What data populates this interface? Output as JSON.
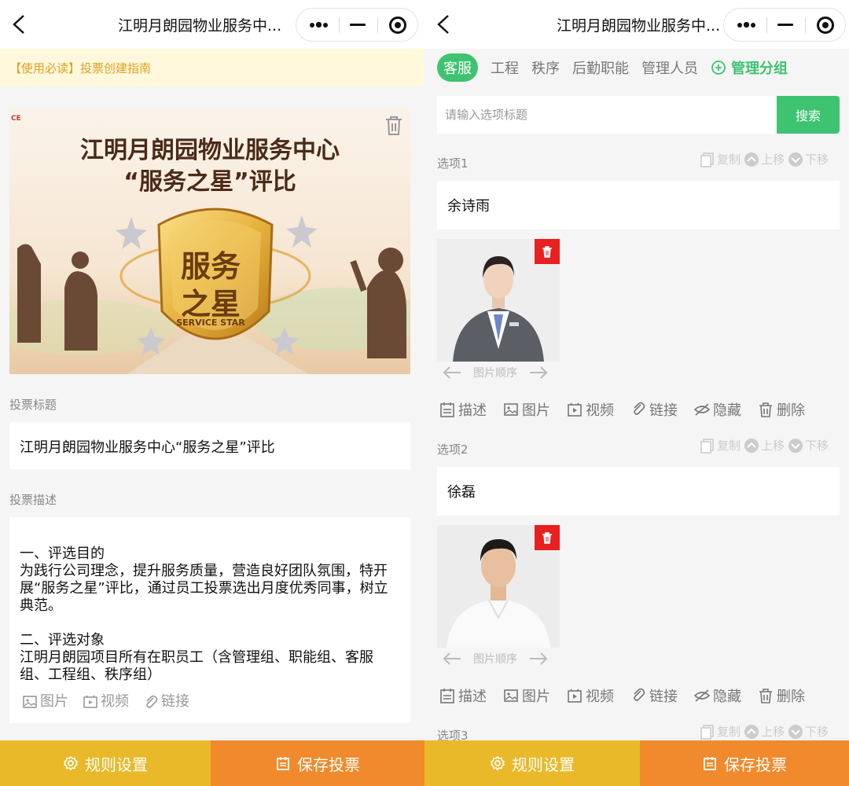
{
  "navbar": {
    "title": "江明月朗园物业服务中..."
  },
  "left": {
    "notice": "【使用必读】投票创建指南",
    "cover": {
      "line1": "江明月朗园物业服务中心",
      "line2": "“服务之星”评比",
      "badge_line1": "服务",
      "badge_line2": "之星",
      "badge_en": "SERVICE STAR",
      "corner": "CE"
    },
    "title_label": "投票标题",
    "title_value": "江明月朗园物业服务中心“服务之星”评比",
    "desc_label": "投票描述",
    "desc_value": "一、评选目的\n为践行公司理念，提升服务质量，营造良好团队氛围，特开展“服务之星”评比，通过员工投票选出月度优秀同事，树立典范。\n\n二、评选对象\n江明月朗园项目所有在职员工（含管理组、职能组、客服组、工程组、秩序组）",
    "media": {
      "image": "图片",
      "video": "视频",
      "link": "链接"
    }
  },
  "right": {
    "tabs": [
      "客服",
      "工程",
      "秩序",
      "后勤职能",
      "管理人员"
    ],
    "manage_group": "管理分组",
    "search": {
      "placeholder": "请输入选项标题",
      "button": "搜索"
    },
    "option_actions": {
      "copy": "复制",
      "up": "上移",
      "down": "下移"
    },
    "photo_order": "图片顺序",
    "tools": {
      "desc": "描述",
      "image": "图片",
      "video": "视频",
      "link": "链接",
      "hide": "隐藏",
      "delete": "删除"
    },
    "options": [
      {
        "label": "选项1",
        "name": "余诗雨"
      },
      {
        "label": "选项2",
        "name": "徐磊"
      },
      {
        "label": "选项3"
      }
    ]
  },
  "bottom": {
    "rules": "规则设置",
    "save": "保存投票"
  },
  "colors": {
    "green": "#3ec371",
    "yellow": "#e9b92a",
    "orange": "#f08a2c",
    "notice_text": "#e0a020"
  }
}
